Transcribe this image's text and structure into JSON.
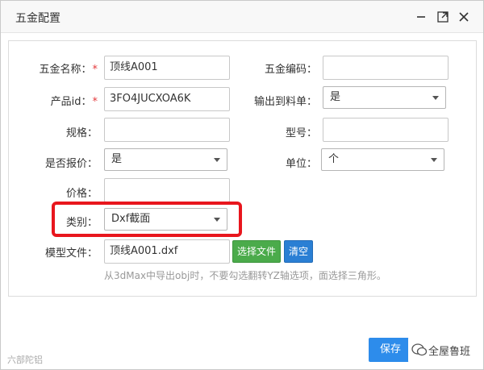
{
  "dialog": {
    "title": "五金配置",
    "icons": [
      "minimize-icon",
      "maximize-icon",
      "close-icon"
    ]
  },
  "form": {
    "name_label": "五金名称：",
    "name_value": "顶线A001",
    "code_label": "五金编码：",
    "code_value": "",
    "product_id_label": "产品id：",
    "product_id_value": "3FO4JUCXOA6K",
    "output_label": "输出到料单：",
    "output_value": "是",
    "spec_label": "规格：",
    "spec_value": "",
    "model_no_label": "型号：",
    "model_no_value": "",
    "quote_label": "是否报价：",
    "quote_value": "是",
    "unit_label": "单位：",
    "unit_value": "个",
    "price_label": "价格：",
    "price_value": "",
    "category_label": "类别：",
    "category_value": "Dxf截面",
    "model_file_label": "模型文件：",
    "model_file_value": "顶线A001.dxf",
    "select_file_button": "选择文件",
    "clear_button": "清空",
    "hint": "从3dMax中导出obj时，不要勾选翻转YZ轴选项，面选择三角形。",
    "required_mark": "*"
  },
  "footer": {
    "save_button": "保存",
    "watermark_right": "全屋鲁班",
    "watermark_left": "六部陀铝"
  },
  "colors": {
    "highlight": "#e8161d",
    "save": "#2d8ceb",
    "select_file": "#4bab4b",
    "clear": "#2a7fd4"
  }
}
